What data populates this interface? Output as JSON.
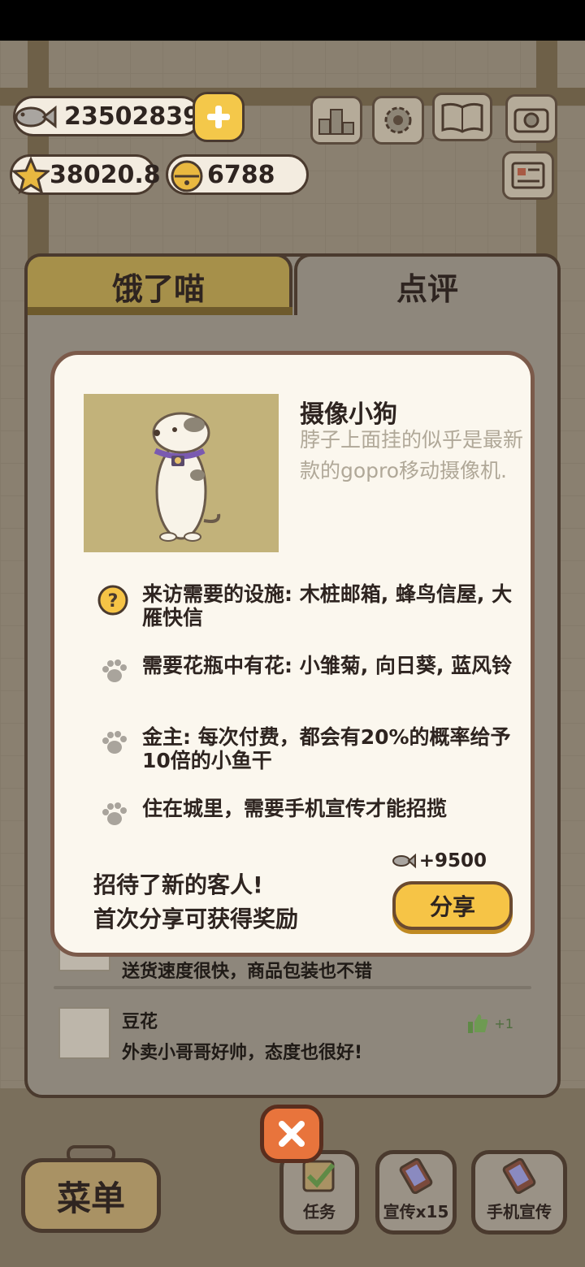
{
  "currency": {
    "fish": "23502839",
    "stars": "38020.8",
    "bells": "6788"
  },
  "tabs": {
    "hungry": "饿了喵",
    "review": "点评"
  },
  "reviews": [
    {
      "name": "",
      "text": "送货速度很快，商品包装也不错"
    },
    {
      "name": "豆花",
      "text": "外卖小哥哥好帅，态度也很好!",
      "likes": "+1"
    }
  ],
  "modal": {
    "title": "摄像小狗",
    "description": "脖子上面挂的似乎是最新款的gopro移动摄像机.",
    "requirements": [
      {
        "icon": "question-icon",
        "text": "来访需要的设施: 木桩邮箱, 蜂鸟信屋, 大雁快信"
      },
      {
        "icon": "paw-icon",
        "text": "需要花瓶中有花: 小雏菊, 向日葵, 蓝风铃"
      },
      {
        "icon": "paw-icon",
        "text": "金主: 每次付费，都会有20%的概率给予10倍的小鱼干"
      },
      {
        "icon": "paw-icon",
        "text": "住在城里，需要手机宣传才能招揽"
      }
    ],
    "reward": "+9500",
    "promo_line1": "招待了新的客人!",
    "promo_line2": "首次分享可获得奖励",
    "share_label": "分享"
  },
  "bottom": {
    "menu_label": "菜单",
    "tasks_label": "任务",
    "promo15_label": "宣传x15",
    "phone_promo_label": "手机宣传"
  },
  "colors": {
    "modal_bg": "#fbf7ee",
    "accent_yellow": "#f6c446",
    "close_orange": "#e8743c",
    "border_brown": "#4a3a2e"
  }
}
